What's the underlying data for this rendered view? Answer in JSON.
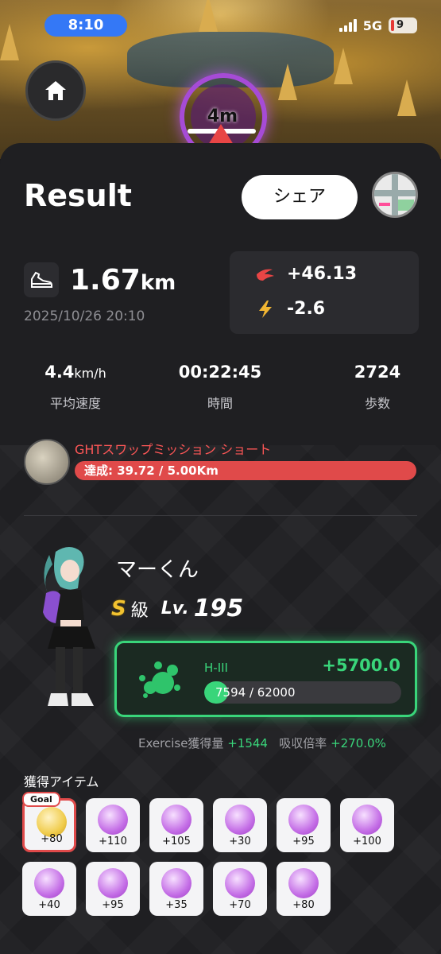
{
  "status": {
    "time": "8:10",
    "network": "5G",
    "battery": "9"
  },
  "map": {
    "distance_indicator": "4m"
  },
  "header": {
    "title": "Result",
    "share_label": "シェア"
  },
  "summary": {
    "distance_value": "1.67",
    "distance_unit": "km",
    "datetime": "2025/10/26 20:10",
    "reward_1": "+46.13",
    "reward_2": "-2.6"
  },
  "stats": [
    {
      "value": "4.4",
      "unit": "km/h",
      "label": "平均速度"
    },
    {
      "value": "00:22:45",
      "unit": "",
      "label": "時間"
    },
    {
      "value": "2724",
      "unit": "",
      "label": "歩数"
    }
  ],
  "mission": {
    "title": "GHTスワップミッション ショート",
    "progress_text": "達成: 39.72 / 5.00Km"
  },
  "character": {
    "name": "マーくん",
    "rank": "S",
    "rank_suffix": "級",
    "level_label": "Lv.",
    "level": "195"
  },
  "energy": {
    "label": "H-III",
    "gain": "+5700.0",
    "progress_text": "7594 / 62000",
    "progress": 0.122
  },
  "exercise": {
    "label": "Exercise獲得量",
    "value": "+1544",
    "rate_label": "吸収倍率",
    "rate_value": "+270.0%"
  },
  "items": {
    "title": "獲得アイテム",
    "goal_tag": "Goal",
    "list": [
      "+80",
      "+110",
      "+105",
      "+30",
      "+95",
      "+100",
      "+40",
      "+95",
      "+35",
      "+70",
      "+80"
    ]
  },
  "colors": {
    "accent_green": "#39d57a",
    "accent_red": "#e04a4a",
    "status_blue": "#3478f6"
  }
}
